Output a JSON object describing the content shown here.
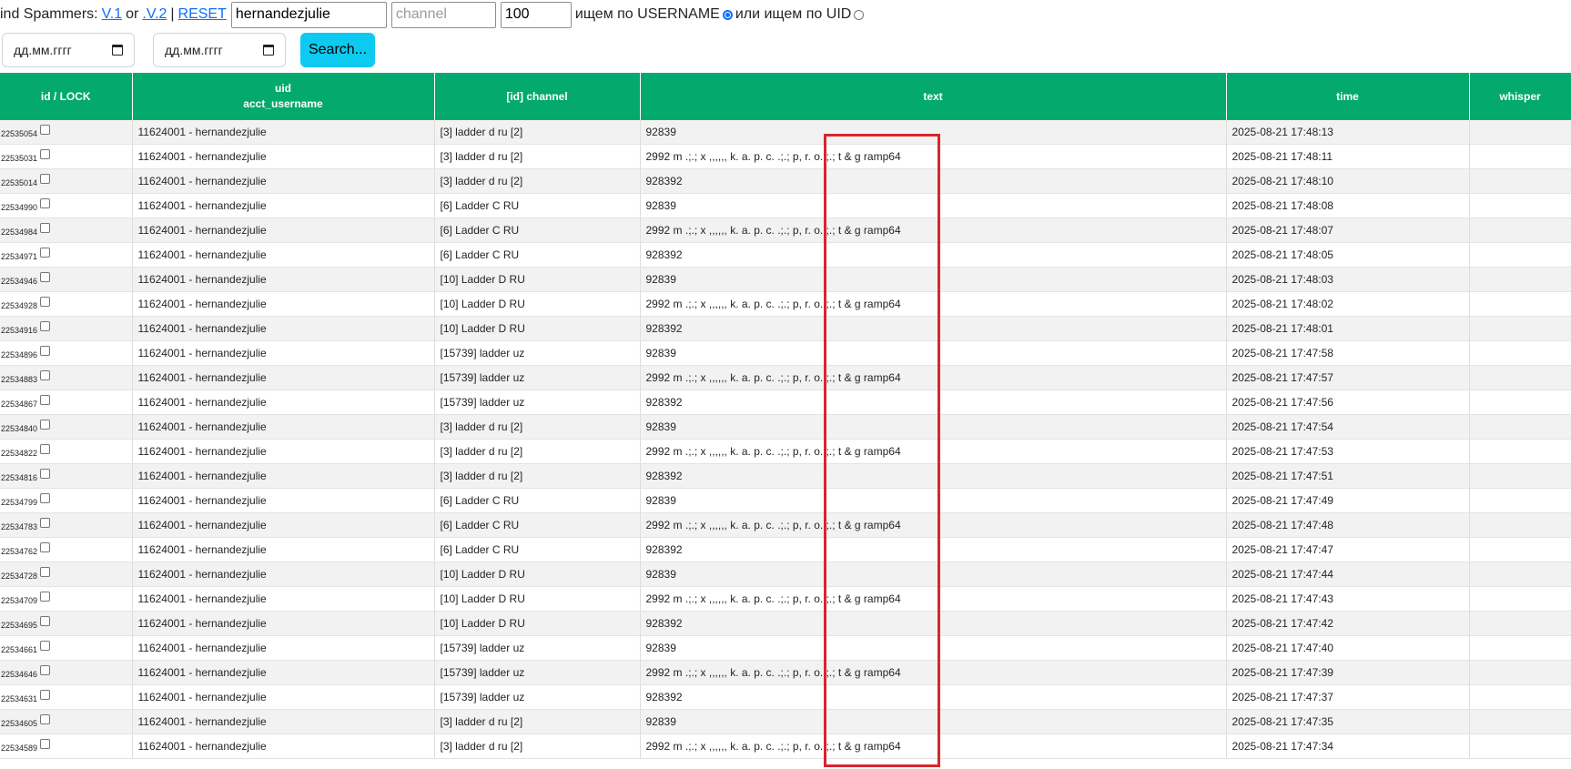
{
  "header": {
    "title_prefix": "ind Spammers:",
    "link_v1": "V.1",
    "or_text": "or",
    "link_v2": ".V.2",
    "separator": "|",
    "link_reset": "RESET",
    "username_value": "hernandezjulie",
    "channel_placeholder": "channel",
    "limit_value": "100",
    "search_by_username_label": "ищем по USERNAME",
    "search_by_uid_label": "или ищем по UID",
    "selected_mode": "username"
  },
  "filters": {
    "date_from_placeholder": "дд.мм.гггг",
    "date_to_placeholder": "дд.мм.гггг",
    "search_button": "Search..."
  },
  "table": {
    "columns": {
      "id_lock": "id / LOCK",
      "uid": "uid",
      "acct_username": "acct_username",
      "channel": "[id] channel",
      "text": "text",
      "time": "time",
      "whisper": "whisper"
    },
    "rows": [
      {
        "id": "22535054",
        "user": "11624001 - hernandezjulie",
        "channel": "[3] ladder d ru [2]",
        "text": "92839",
        "time": "2025-08-21 17:48:13"
      },
      {
        "id": "22535031",
        "user": "11624001 - hernandezjulie",
        "channel": "[3] ladder d ru [2]",
        "text": "2992 m .;.; x ,,,,,, k. a. p. c. .;.; p, r. o. ;.; t & g ramp64",
        "time": "2025-08-21 17:48:11"
      },
      {
        "id": "22535014",
        "user": "11624001 - hernandezjulie",
        "channel": "[3] ladder d ru [2]",
        "text": "928392",
        "time": "2025-08-21 17:48:10"
      },
      {
        "id": "22534990",
        "user": "11624001 - hernandezjulie",
        "channel": "[6] Ladder C RU",
        "text": "92839",
        "time": "2025-08-21 17:48:08"
      },
      {
        "id": "22534984",
        "user": "11624001 - hernandezjulie",
        "channel": "[6] Ladder C RU",
        "text": "2992 m .;.; x ,,,,,, k. a. p. c. .;.; p, r. o. ;.; t & g ramp64",
        "time": "2025-08-21 17:48:07"
      },
      {
        "id": "22534971",
        "user": "11624001 - hernandezjulie",
        "channel": "[6] Ladder C RU",
        "text": "928392",
        "time": "2025-08-21 17:48:05"
      },
      {
        "id": "22534946",
        "user": "11624001 - hernandezjulie",
        "channel": "[10] Ladder D RU",
        "text": "92839",
        "time": "2025-08-21 17:48:03"
      },
      {
        "id": "22534928",
        "user": "11624001 - hernandezjulie",
        "channel": "[10] Ladder D RU",
        "text": "2992 m .;.; x ,,,,,, k. a. p. c. .;.; p, r. o. ;.; t & g ramp64",
        "time": "2025-08-21 17:48:02"
      },
      {
        "id": "22534916",
        "user": "11624001 - hernandezjulie",
        "channel": "[10] Ladder D RU",
        "text": "928392",
        "time": "2025-08-21 17:48:01"
      },
      {
        "id": "22534896",
        "user": "11624001 - hernandezjulie",
        "channel": "[15739] ladder uz",
        "text": "92839",
        "time": "2025-08-21 17:47:58"
      },
      {
        "id": "22534883",
        "user": "11624001 - hernandezjulie",
        "channel": "[15739] ladder uz",
        "text": "2992 m .;.; x ,,,,,, k. a. p. c. .;.; p, r. o. ;.; t & g ramp64",
        "time": "2025-08-21 17:47:57"
      },
      {
        "id": "22534867",
        "user": "11624001 - hernandezjulie",
        "channel": "[15739] ladder uz",
        "text": "928392",
        "time": "2025-08-21 17:47:56"
      },
      {
        "id": "22534840",
        "user": "11624001 - hernandezjulie",
        "channel": "[3] ladder d ru [2]",
        "text": "92839",
        "time": "2025-08-21 17:47:54"
      },
      {
        "id": "22534822",
        "user": "11624001 - hernandezjulie",
        "channel": "[3] ladder d ru [2]",
        "text": "2992 m .;.; x ,,,,,, k. a. p. c. .;.; p, r. o. ;.; t & g ramp64",
        "time": "2025-08-21 17:47:53"
      },
      {
        "id": "22534816",
        "user": "11624001 - hernandezjulie",
        "channel": "[3] ladder d ru [2]",
        "text": "928392",
        "time": "2025-08-21 17:47:51"
      },
      {
        "id": "22534799",
        "user": "11624001 - hernandezjulie",
        "channel": "[6] Ladder C RU",
        "text": "92839",
        "time": "2025-08-21 17:47:49"
      },
      {
        "id": "22534783",
        "user": "11624001 - hernandezjulie",
        "channel": "[6] Ladder C RU",
        "text": "2992 m .;.; x ,,,,,, k. a. p. c. .;.; p, r. o. ;.; t & g ramp64",
        "time": "2025-08-21 17:47:48"
      },
      {
        "id": "22534762",
        "user": "11624001 - hernandezjulie",
        "channel": "[6] Ladder C RU",
        "text": "928392",
        "time": "2025-08-21 17:47:47"
      },
      {
        "id": "22534728",
        "user": "11624001 - hernandezjulie",
        "channel": "[10] Ladder D RU",
        "text": "92839",
        "time": "2025-08-21 17:47:44"
      },
      {
        "id": "22534709",
        "user": "11624001 - hernandezjulie",
        "channel": "[10] Ladder D RU",
        "text": "2992 m .;.; x ,,,,,, k. a. p. c. .;.; p, r. o. ;.; t & g ramp64",
        "time": "2025-08-21 17:47:43"
      },
      {
        "id": "22534695",
        "user": "11624001 - hernandezjulie",
        "channel": "[10] Ladder D RU",
        "text": "928392",
        "time": "2025-08-21 17:47:42"
      },
      {
        "id": "22534661",
        "user": "11624001 - hernandezjulie",
        "channel": "[15739] ladder uz",
        "text": "92839",
        "time": "2025-08-21 17:47:40"
      },
      {
        "id": "22534646",
        "user": "11624001 - hernandezjulie",
        "channel": "[15739] ladder uz",
        "text": "2992 m .;.; x ,,,,,, k. a. p. c. .;.; p, r. o. ;.; t & g ramp64",
        "time": "2025-08-21 17:47:39"
      },
      {
        "id": "22534631",
        "user": "11624001 - hernandezjulie",
        "channel": "[15739] ladder uz",
        "text": "928392",
        "time": "2025-08-21 17:47:37"
      },
      {
        "id": "22534605",
        "user": "11624001 - hernandezjulie",
        "channel": "[3] ladder d ru [2]",
        "text": "92839",
        "time": "2025-08-21 17:47:35"
      },
      {
        "id": "22534589",
        "user": "11624001 - hernandezjulie",
        "channel": "[3] ladder d ru [2]",
        "text": "2992 m .;.; x ,,,,,, k. a. p. c. .;.; p, r. o. ;.; t & g ramp64",
        "time": "2025-08-21 17:47:34"
      }
    ]
  },
  "annotation": {
    "highlight_color": "#d9262c"
  },
  "colors": {
    "header_green": "#04aa6d",
    "search_button": "#0dcaf0",
    "link_blue": "#0d6efd"
  }
}
